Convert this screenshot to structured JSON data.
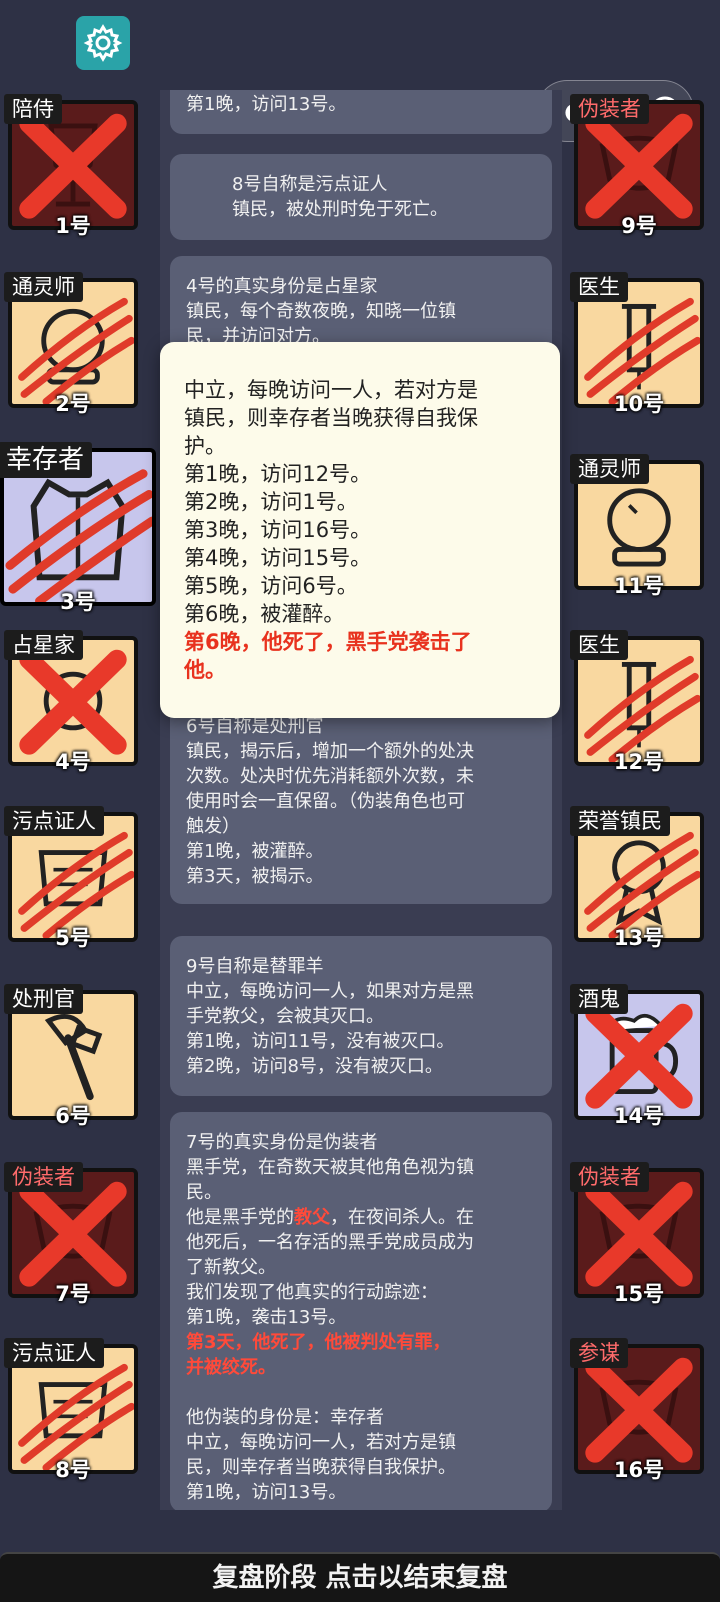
{
  "colors": {
    "background": "#2e3145",
    "card": "#5a5f75",
    "popup": "#fdfbea",
    "alert_red": "#ff4a3a",
    "town_tile": "#f9d8a0",
    "dead_tile": "#5a1b1b",
    "neutral_tile": "#c7c6ec"
  },
  "toolbar": {
    "settings_icon": "gear-icon"
  },
  "capsule": {
    "more_icon": "more-dots-icon",
    "close_icon": "target-close-icon"
  },
  "players_left": [
    {
      "role": "陪侍",
      "number": "1号",
      "status": "dead-x",
      "icon": "wine-glass-icon"
    },
    {
      "role": "通灵师",
      "number": "2号",
      "status": "slashed",
      "icon": "crystal-ball-icon"
    },
    {
      "role": "幸存者",
      "number": "3号",
      "status": "slashed",
      "icon": "vest-icon"
    },
    {
      "role": "占星家",
      "number": "4号",
      "status": "dead-x",
      "icon": "astrolabe-icon"
    },
    {
      "role": "污点证人",
      "number": "5号",
      "status": "slashed",
      "icon": "scroll-icon"
    },
    {
      "role": "处刑官",
      "number": "6号",
      "status": "alive",
      "icon": "axe-icon"
    },
    {
      "role": "伪装者",
      "number": "7号",
      "status": "dead-x",
      "icon": "mask-icon"
    },
    {
      "role": "污点证人",
      "number": "8号",
      "status": "slashed",
      "icon": "scroll-icon"
    }
  ],
  "players_right": [
    {
      "role": "伪装者",
      "number": "9号",
      "status": "dead-x",
      "icon": "mask-icon"
    },
    {
      "role": "医生",
      "number": "10号",
      "status": "slashed",
      "icon": "syringe-icon"
    },
    {
      "role": "通灵师",
      "number": "11号",
      "status": "alive",
      "icon": "crystal-ball-icon"
    },
    {
      "role": "医生",
      "number": "12号",
      "status": "slashed",
      "icon": "syringe-icon"
    },
    {
      "role": "荣誉镇民",
      "number": "13号",
      "status": "slashed",
      "icon": "medal-icon"
    },
    {
      "role": "酒鬼",
      "number": "14号",
      "status": "dead-x",
      "icon": "beer-icon"
    },
    {
      "role": "伪装者",
      "number": "15号",
      "status": "dead-x",
      "icon": "mask-icon"
    },
    {
      "role": "参谋",
      "number": "16号",
      "status": "dead-x",
      "icon": "mask-icon"
    }
  ],
  "log": {
    "card0": {
      "l1": "第1晚，访问13号。"
    },
    "card1": {
      "l1": "8号自称是污点证人",
      "l2": "镇民，被处刑时免于死亡。"
    },
    "card2": {
      "l1": "4号的真实身份是占星家",
      "l2": "镇民，每个奇数夜晚，知晓一位镇",
      "l3": "民，并访问对方。"
    },
    "card3": {
      "l1": "6号自称是处刑官",
      "l2": "镇民，揭示后，增加一个额外的处决",
      "l3": "次数。处决时优先消耗额外次数，未",
      "l4": "使用时会一直保留。（伪装角色也可",
      "l5": "触发）",
      "l6": "第1晚，被灌醉。",
      "l7": "第3天，被揭示。"
    },
    "card4": {
      "l1": "9号自称是替罪羊",
      "l2": "中立，每晚访问一人，如果对方是黑",
      "l3": "手党教父，会被其灭口。",
      "l4": "第1晚，访问11号，没有被灭口。",
      "l5": "第2晚，访问8号，没有被灭口。"
    },
    "card5": {
      "l1": "7号的真实身份是伪装者",
      "l2": "黑手党，在奇数天被其他角色视为镇",
      "l3": "民。",
      "l4a": "他是黑手党的",
      "l4b": "教父",
      "l4c": "，在夜间杀人。在",
      "l5": "他死后，一名存活的黑手党成员成为",
      "l6": "了新教父。",
      "l7": "我们发现了他真实的行动踪迹：",
      "l8": "第1晚，袭击13号。",
      "l9": "第3天，他死了，他被判处有罪，",
      "l10": "并被绞死。",
      "l11": "他伪装的身份是：幸存者",
      "l12": "中立，每晚访问一人，若对方是镇",
      "l13": "民，则幸存者当晚获得自我保护。",
      "l14": "第1晚，访问13号。"
    }
  },
  "popup": {
    "l1": "中立，每晚访问一人，若对方是",
    "l2": "镇民，则幸存者当晚获得自我保",
    "l3": "护。",
    "l4": "第1晚，访问12号。",
    "l5": "第2晚，访问1号。",
    "l6": "第3晚，访问16号。",
    "l7": "第4晚，访问15号。",
    "l8": "第5晚，访问6号。",
    "l9": "第6晚，被灌醉。",
    "l10": "第6晚，他死了，黑手党袭击了",
    "l11": "他。"
  },
  "bottom_bar": {
    "label": "复盘阶段 点击以结束复盘"
  }
}
